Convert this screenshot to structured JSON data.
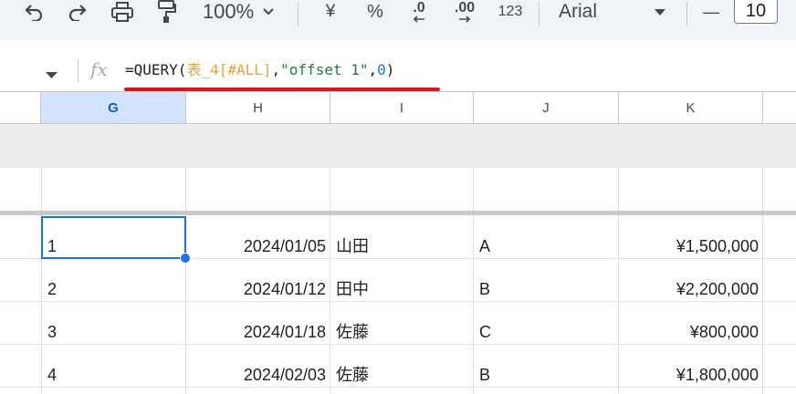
{
  "toolbar": {
    "zoom": "100%",
    "currency": "¥",
    "percent": "%",
    "decrease_decimal": ".0",
    "increase_decimal": ".00",
    "more_formats": "123",
    "font_name": "Arial",
    "font_size_minus": "—",
    "font_size": "10"
  },
  "formula_bar": {
    "fx_icon": "fx",
    "formula_parts": {
      "p1": "=QUERY(",
      "p2": "表_4[#ALL]",
      "p3": ",",
      "p4": "\"offset 1\"",
      "p5": ",",
      "p6": "0",
      "p7": ")"
    }
  },
  "columns": [
    "G",
    "H",
    "I",
    "J",
    "K"
  ],
  "rows": [
    {
      "g": "1",
      "h": "2024/01/05",
      "i": "山田",
      "j": "A",
      "k": "¥1,500,000"
    },
    {
      "g": "2",
      "h": "2024/01/12",
      "i": "田中",
      "j": "B",
      "k": "¥2,200,000"
    },
    {
      "g": "3",
      "h": "2024/01/18",
      "i": "佐藤",
      "j": "C",
      "k": "¥800,000"
    },
    {
      "g": "4",
      "h": "2024/02/03",
      "i": "佐藤",
      "j": "B",
      "k": "¥1,800,000"
    }
  ],
  "colors": {
    "accent": "#1a73e8",
    "annotation_red": "#e0151b",
    "selected_header": "#d3e3fd"
  }
}
